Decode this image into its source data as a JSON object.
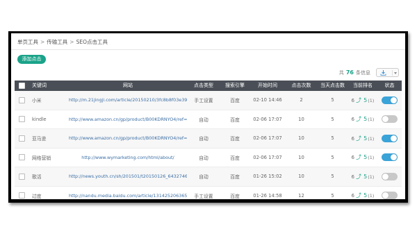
{
  "breadcrumb": {
    "items": [
      "单页工具",
      "传输工具",
      "SEO点击工具"
    ],
    "separator": ">"
  },
  "toolbar": {
    "add_button_label": "添加点击",
    "summary_prefix": "共",
    "total_count": "76",
    "summary_suffix": "条信息"
  },
  "table": {
    "headers": {
      "keyword": "关键词",
      "url": "网站",
      "click_type": "点击类型",
      "engine": "搜索引擎",
      "start_time": "开始时间",
      "clicks": "点击次数",
      "today_clicks": "当天点击数",
      "rank": "当前排名",
      "status": "状态"
    },
    "rows": [
      {
        "keyword": "小米",
        "url": "http://m.21jingji.com/article/20150210/3fc8b8f03e399db...",
        "click_type": "手工设置",
        "engine": "百度",
        "start_time": "02-10 14:46",
        "clicks": "2",
        "today_clicks": "5",
        "rank_a": "6",
        "rank_b": "5",
        "rank_c": "(1)",
        "status": "on"
      },
      {
        "keyword": "kindle",
        "url": "http://www.amazon.cn/gp/product/B00KDRNYO4/ref=a...",
        "click_type": "自动",
        "engine": "百度",
        "start_time": "02-06 17:07",
        "clicks": "10",
        "today_clicks": "5",
        "rank_a": "6",
        "rank_b": "5",
        "rank_c": "(1)",
        "status": "off"
      },
      {
        "keyword": "亚马逊",
        "url": "http://www.amazon.cn/gp/product/B00KDRNYO4/ref=a...",
        "click_type": "自动",
        "engine": "百度",
        "start_time": "02-06 17:07",
        "clicks": "10",
        "today_clicks": "5",
        "rank_a": "6",
        "rank_b": "5",
        "rank_c": "(1)",
        "status": "on"
      },
      {
        "keyword": "网络营销",
        "url": "http://www.wymarketing.com/html/about/",
        "click_type": "自动",
        "engine": "百度",
        "start_time": "02-06 17:07",
        "clicks": "10",
        "today_clicks": "5",
        "rank_a": "6",
        "rank_b": "5",
        "rank_c": "(1)",
        "status": "on"
      },
      {
        "keyword": "歌活",
        "url": "http://news.youth.cn/sh/201501/t20150126_6432746.htm",
        "click_type": "自动",
        "engine": "百度",
        "start_time": "01-26 15:02",
        "clicks": "10",
        "today_clicks": "5",
        "rank_a": "6",
        "rank_b": "5",
        "rank_c": "(1)",
        "status": "off"
      },
      {
        "keyword": "过度",
        "url": "http://nandu.media.baidu.com/article/131425206365153...",
        "click_type": "手工设置",
        "engine": "百度",
        "start_time": "01-26 14:58",
        "clicks": "12",
        "today_clicks": "5",
        "rank_a": "6",
        "rank_b": "5",
        "rank_c": "(1)",
        "status": "off"
      }
    ]
  },
  "colors": {
    "accent": "#1aa389",
    "header_bg": "#4a4f57",
    "toggle_on": "#3aa3d8",
    "toggle_off": "#c8c8c8"
  },
  "icons": {
    "export": "download-icon",
    "rank_trend": "trend-up-icon"
  }
}
